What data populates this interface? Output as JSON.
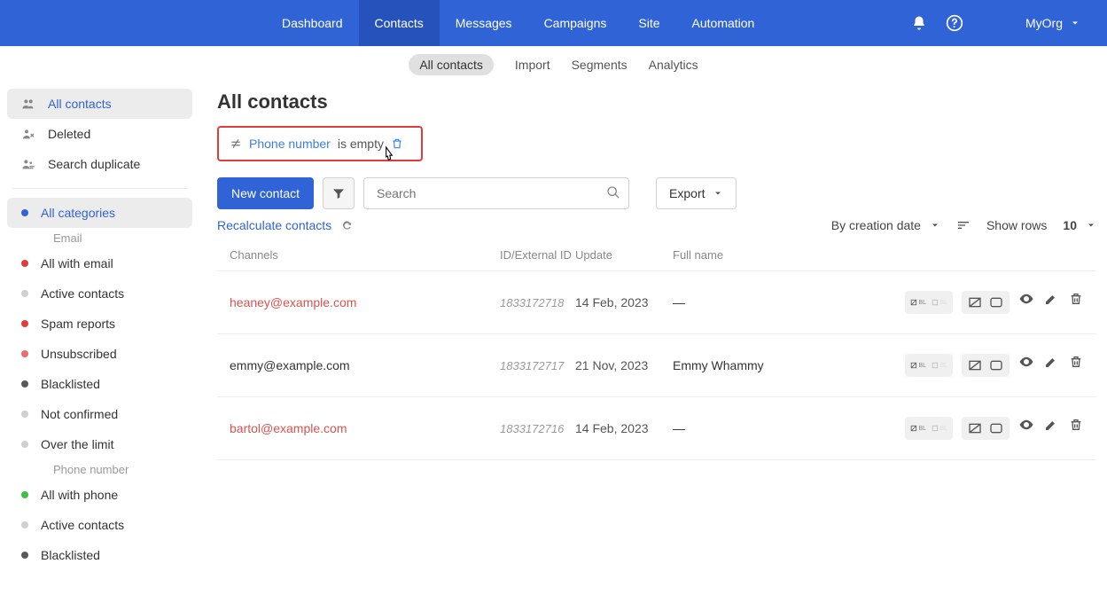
{
  "nav": {
    "items": [
      "Dashboard",
      "Contacts",
      "Messages",
      "Campaigns",
      "Site",
      "Automation"
    ],
    "active": 1,
    "org": "MyOrg"
  },
  "subtabs": {
    "items": [
      "All contacts",
      "Import",
      "Segments",
      "Analytics"
    ],
    "active": 0
  },
  "sidebar": {
    "top": [
      {
        "label": "All contacts",
        "icon": "people",
        "active": true
      },
      {
        "label": "Deleted",
        "icon": "person-x"
      },
      {
        "label": "Search duplicate",
        "icon": "settings-people"
      }
    ],
    "categoriesHeader": "All categories",
    "emailHeader": "Email",
    "emailItems": [
      {
        "label": "All with email",
        "color": "#e23b3b"
      },
      {
        "label": "Active contacts",
        "color": "#cfcfcf"
      },
      {
        "label": "Spam reports",
        "color": "#e23b3b"
      },
      {
        "label": "Unsubscribed",
        "color": "#ef6a6a"
      },
      {
        "label": "Blacklisted",
        "color": "#5a5a5a"
      },
      {
        "label": "Not confirmed",
        "color": "#cfcfcf"
      },
      {
        "label": "Over the limit",
        "color": "#cfcfcf"
      }
    ],
    "phoneHeader": "Phone number",
    "phoneItems": [
      {
        "label": "All with phone",
        "color": "#3fbf3f"
      },
      {
        "label": "Active contacts",
        "color": "#cfcfcf"
      },
      {
        "label": "Blacklisted",
        "color": "#5a5a5a"
      }
    ]
  },
  "page": {
    "title": "All contacts",
    "filter": {
      "field": "Phone number",
      "cond": "is empty"
    },
    "newContact": "New contact",
    "searchPlaceholder": "Search",
    "export": "Export",
    "recalc": "Recalculate contacts",
    "sortLabel": "By creation date",
    "showRows": "Show rows",
    "rowsValue": "10"
  },
  "table": {
    "headers": {
      "channels": "Channels",
      "id": "ID/External ID",
      "update": "Update",
      "fullname": "Full name"
    },
    "rows": [
      {
        "email": "heaney@example.com",
        "warn": true,
        "id": "1833172718",
        "update": "14 Feb, 2023",
        "fullname": "—"
      },
      {
        "email": "emmy@example.com",
        "warn": false,
        "id": "1833172717",
        "update": "21 Nov, 2023",
        "fullname": "Emmy Whammy"
      },
      {
        "email": "bartol@example.com",
        "warn": true,
        "id": "1833172716",
        "update": "14 Feb, 2023",
        "fullname": "—"
      }
    ]
  }
}
